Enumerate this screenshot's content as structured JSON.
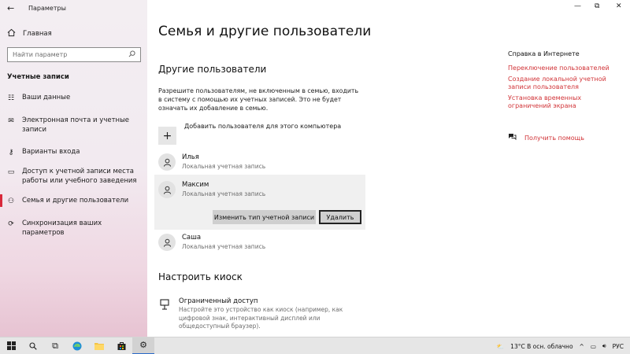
{
  "window": {
    "title": "Параметры",
    "minimize_icon": "minimize-icon",
    "restore_icon": "restore-icon",
    "close_icon": "close-icon"
  },
  "sidebar": {
    "home_label": "Главная",
    "search_placeholder": "Найти параметр",
    "section_label": "Учетные записи",
    "items": [
      {
        "label": "Ваши данные",
        "icon": "person-card-icon"
      },
      {
        "label": "Электронная почта и учетные записи",
        "icon": "mail-icon"
      },
      {
        "label": "Варианты входа",
        "icon": "key-icon"
      },
      {
        "label": "Доступ к учетной записи места работы или учебного заведения",
        "icon": "briefcase-icon"
      },
      {
        "label": "Семья и другие пользователи",
        "icon": "family-icon"
      },
      {
        "label": "Синхронизация ваших параметров",
        "icon": "sync-icon"
      }
    ]
  },
  "main": {
    "page_title": "Семья и другие пользователи",
    "other_users_title": "Другие пользователи",
    "description": "Разрешите пользователям, не включенным в семью, входить в систему с помощью их учетных записей. Это не будет означать их добавление в семью.",
    "add_user_label": "Добавить пользователя для этого компьютера",
    "users": [
      {
        "name": "Илья",
        "type": "Локальная учетная запись"
      },
      {
        "name": "Максим",
        "type": "Локальная учетная запись"
      },
      {
        "name": "Саша",
        "type": "Локальная учетная запись"
      }
    ],
    "change_type_button": "Изменить тип учетной записи",
    "delete_button": "Удалить",
    "kiosk_title": "Настроить киоск",
    "kiosk_item_title": "Ограниченный доступ",
    "kiosk_item_desc": "Настройте это устройство как киоск (например, как цифровой знак, интерактивный дисплей или общедоступный браузер)."
  },
  "help": {
    "title": "Справка в Интернете",
    "links": [
      "Переключение пользователей",
      "Создание локальной учетной записи пользователя",
      "Установка временных ограничений экрана"
    ],
    "get_help": "Получить помощь"
  },
  "taskbar": {
    "weather": "13°C  В осн. облачно",
    "language": "РУС"
  }
}
